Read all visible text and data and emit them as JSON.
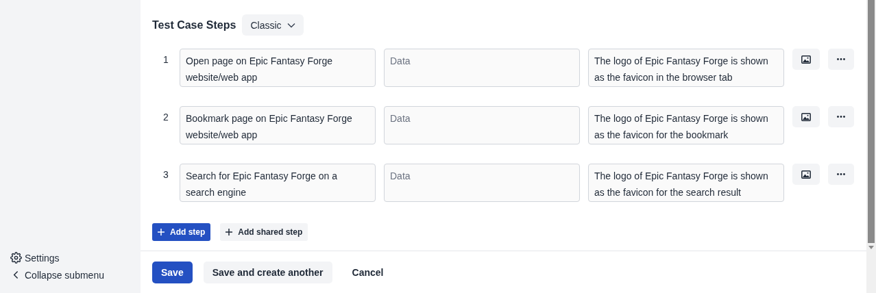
{
  "sidebar": {
    "items": [
      {
        "kind": "settings",
        "label": "Settings"
      },
      {
        "kind": "collapse",
        "label": "Collapse submenu"
      }
    ]
  },
  "section": {
    "title": "Test Case Steps",
    "view_selector": "Classic"
  },
  "steps": [
    {
      "number": "1",
      "step": "Open page on Epic Fantasy Forge website/web app",
      "data": {
        "placeholder": "Data"
      },
      "expected": "The logo of Epic Fantasy Forge is shown as the favicon in the browser tab"
    },
    {
      "number": "2",
      "step": "Bookmark page on Epic Fantasy Forge website/web app",
      "data": {
        "placeholder": "Data"
      },
      "expected": "The logo of Epic Fantasy Forge is shown as the favicon for the bookmark"
    },
    {
      "number": "3",
      "step": "Search for Epic Fantasy Forge on a search engine",
      "data": {
        "placeholder": "Data"
      },
      "expected": "The logo of Epic Fantasy Forge is shown as the favicon for the search result"
    }
  ],
  "step_actions": [
    {
      "kind": "primary",
      "label": "Add step"
    },
    {
      "kind": "secondary",
      "label": "Add shared step"
    }
  ],
  "footer": {
    "buttons": [
      {
        "kind": "primary",
        "label": "Save"
      },
      {
        "kind": "secondary",
        "label": "Save and create another"
      },
      {
        "kind": "plain",
        "label": "Cancel"
      }
    ]
  }
}
